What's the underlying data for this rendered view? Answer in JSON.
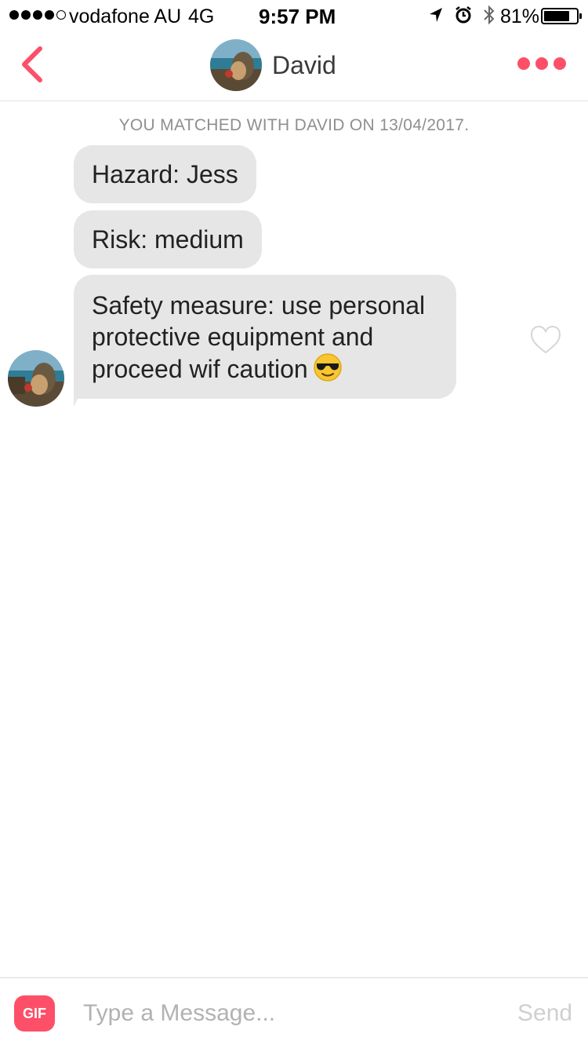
{
  "status_bar": {
    "carrier": "vodafone AU",
    "network": "4G",
    "time": "9:57 PM",
    "battery_percent": "81%",
    "battery_level": 0.81,
    "signal_bars_filled": 4,
    "signal_bars_total": 5,
    "icons": [
      "location-arrow-icon",
      "alarm-clock-icon",
      "bluetooth-icon",
      "battery-icon"
    ]
  },
  "header": {
    "back_icon": "chevron-left-icon",
    "title": "David",
    "more_icon": "more-dots-icon"
  },
  "conversation": {
    "match_notice": "YOU MATCHED WITH DAVID ON 13/04/2017.",
    "messages": [
      {
        "text": "Hazard: Jess"
      },
      {
        "text": "Risk: medium"
      },
      {
        "line1": "Safety measure: use personal",
        "line2": "protective equipment and",
        "line3": "proceed wif caution",
        "emoji": "sunglasses-face-emoji"
      }
    ],
    "like_icon": "heart-outline-icon"
  },
  "composer": {
    "gif_label": "GIF",
    "input_placeholder": "Type a Message...",
    "input_value": "",
    "send_label": "Send"
  },
  "colors": {
    "accent": "#fd4f68",
    "bubble": "#e6e6e6",
    "muted_text": "#8f8f8f",
    "send_disabled": "#cfcfcf"
  }
}
